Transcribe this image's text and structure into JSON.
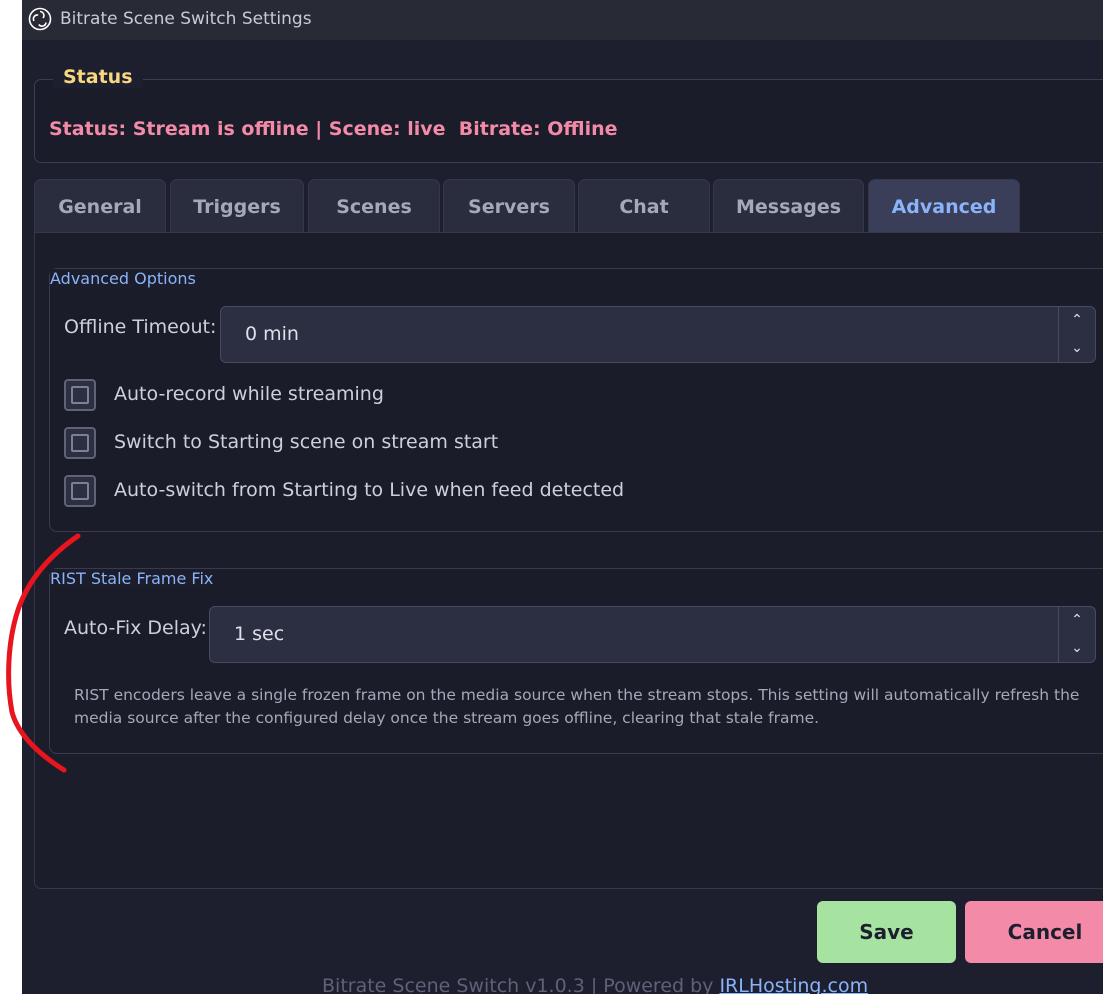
{
  "window": {
    "title": "Bitrate Scene Switch Settings",
    "icon": "obs-logo-icon"
  },
  "status": {
    "legend": "Status",
    "text": "Status: Stream is offline | Scene: live  Bitrate: Offline"
  },
  "tabs": [
    {
      "label": "General",
      "active": false
    },
    {
      "label": "Triggers",
      "active": false
    },
    {
      "label": "Scenes",
      "active": false
    },
    {
      "label": "Servers",
      "active": false
    },
    {
      "label": "Chat",
      "active": false
    },
    {
      "label": "Messages",
      "active": false
    },
    {
      "label": "Advanced",
      "active": true
    }
  ],
  "advanced_options": {
    "legend": "Advanced Options",
    "offline_timeout_label": "Offline Timeout:",
    "offline_timeout_value": "0 min",
    "checkboxes": [
      {
        "label": "Auto-record while streaming",
        "checked": false
      },
      {
        "label": "Switch to Starting scene on stream start",
        "checked": false
      },
      {
        "label": "Auto-switch from Starting to Live when feed detected",
        "checked": false
      }
    ]
  },
  "rist": {
    "legend": "RIST Stale Frame Fix",
    "delay_label": "Auto-Fix Delay:",
    "delay_value": "1 sec",
    "description": "RIST encoders leave a single frozen frame on the media source when the stream stops. This setting will automatically refresh the media source after the configured delay once the stream goes offline, clearing that stale frame."
  },
  "buttons": {
    "save": "Save",
    "cancel": "Cancel"
  },
  "footer": {
    "text": "Bitrate Scene Switch v1.0.3 | Powered by ",
    "link": "IRLHosting.com"
  },
  "colors": {
    "background": "#1e1f2e",
    "status_text": "#f38ba8",
    "status_legend": "#f7d77f",
    "accent": "#89b4fa",
    "save": "#a6e3a1",
    "cancel": "#f38ba8",
    "annotation": "#e8141e"
  }
}
